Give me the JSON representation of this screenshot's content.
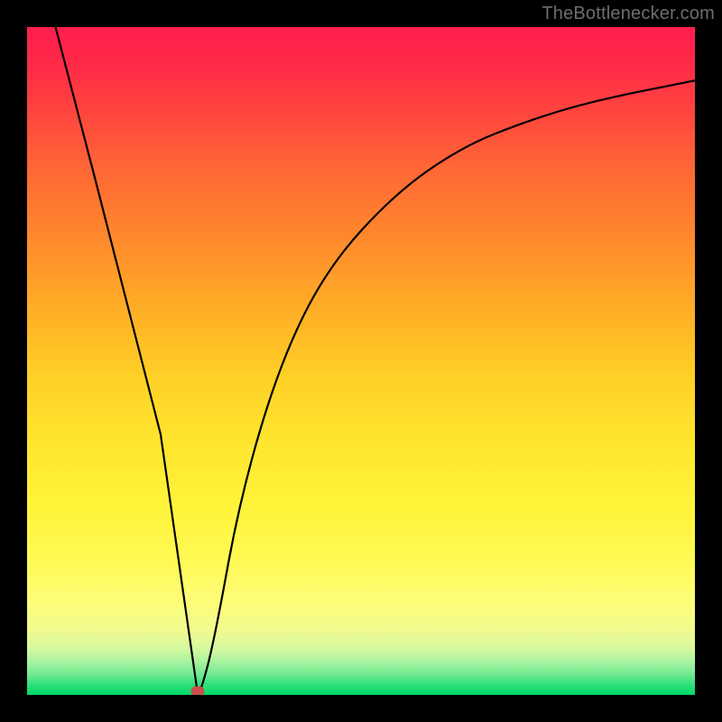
{
  "watermark": {
    "text": "TheBottlenecker.com"
  },
  "colors": {
    "frame": "#000000",
    "gradient_top": "#ff1e4e",
    "gradient_mid": "#ffe52e",
    "gradient_bottom": "#00d867",
    "curve": "#000000",
    "marker": "#c94f48",
    "watermark_text": "#6e6e6e"
  },
  "chart_data": {
    "type": "line",
    "title": "",
    "xlabel": "",
    "ylabel": "",
    "xlim": [
      0,
      100
    ],
    "ylim": [
      0,
      100
    ],
    "grid": false,
    "legend": false,
    "series": [
      {
        "name": "bottleneck-curve",
        "x": [
          4,
          10,
          20,
          25.5,
          26,
          28,
          32,
          38,
          45,
          55,
          65,
          75,
          85,
          100
        ],
        "values": [
          101,
          78,
          39,
          0.5,
          0.5,
          8,
          30,
          50,
          64,
          75,
          82,
          86,
          89,
          92
        ]
      }
    ],
    "annotations": [
      {
        "name": "minimum-marker",
        "x": 25.5,
        "y": 0.5
      }
    ]
  }
}
